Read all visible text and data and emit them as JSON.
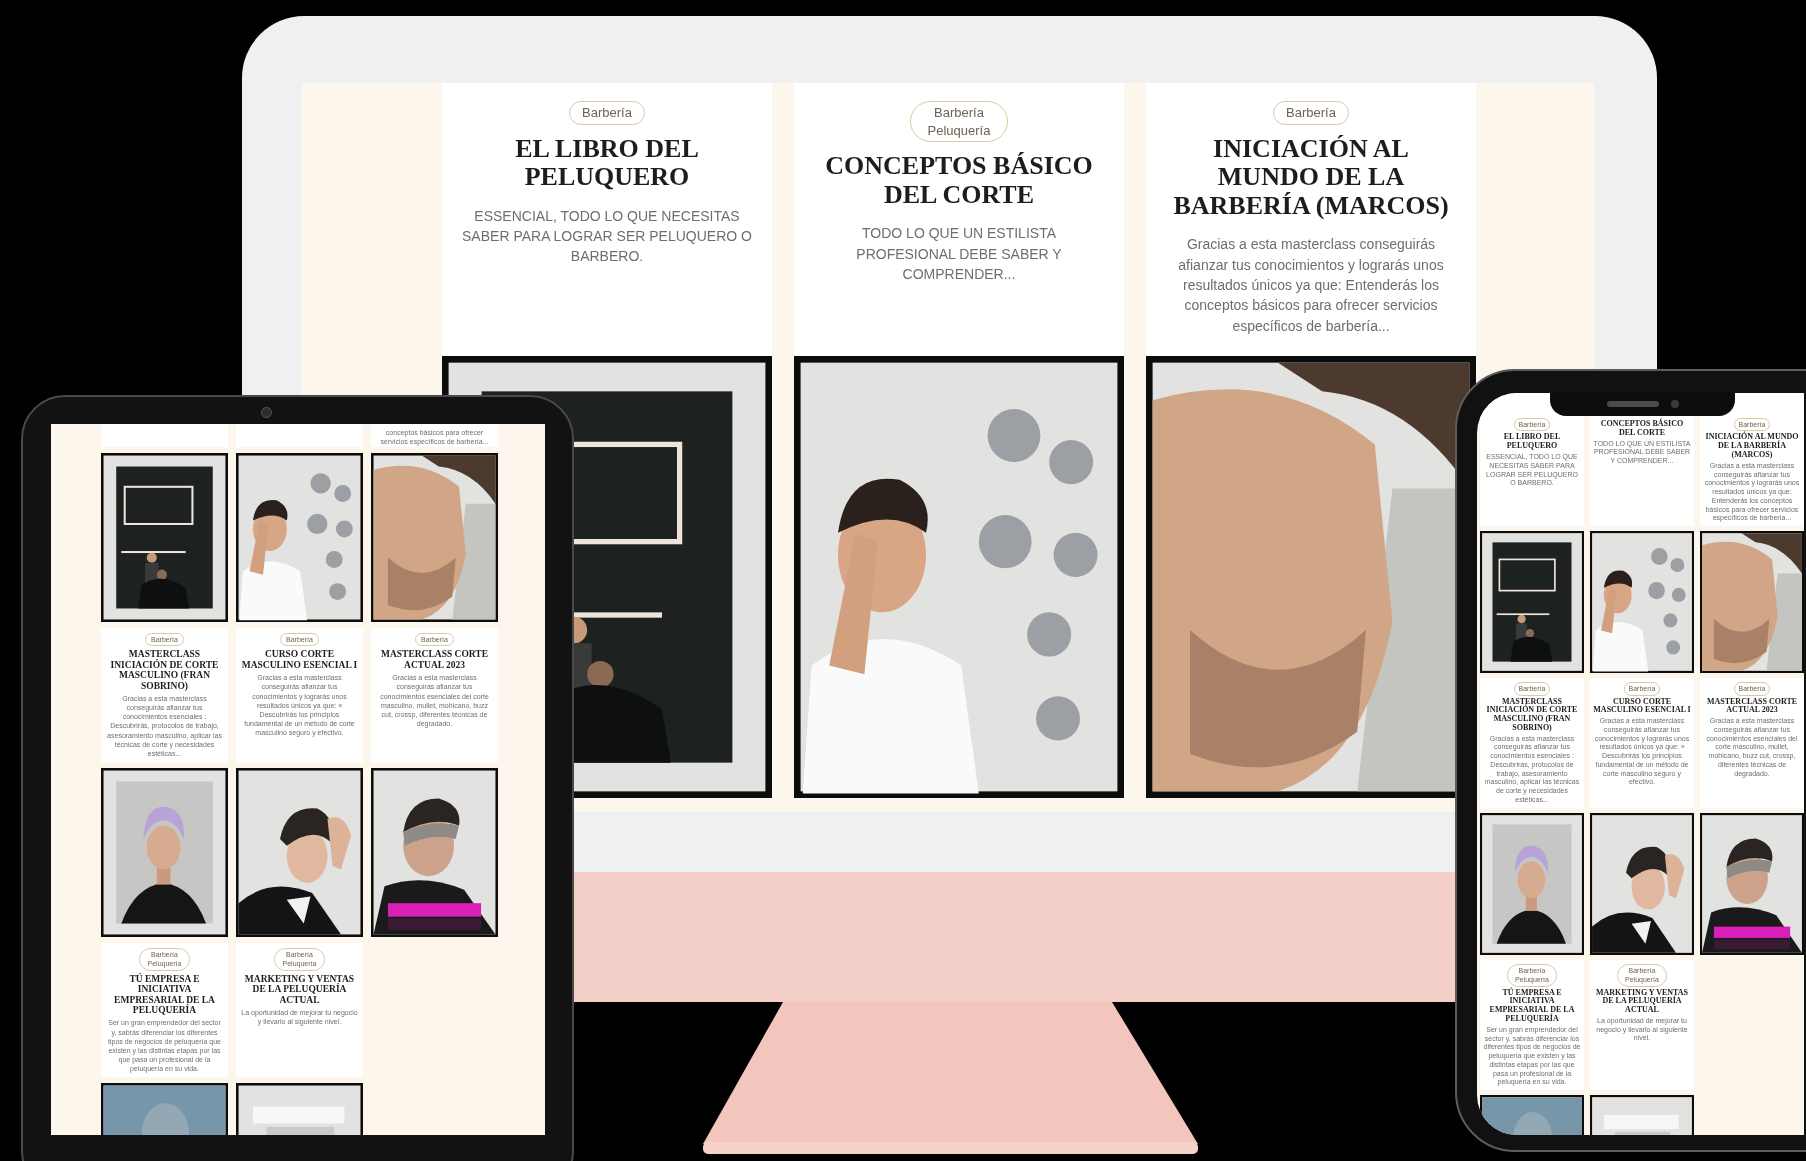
{
  "devices": [
    {
      "kind": "desktop",
      "cards": [
        {
          "tag": "Barbería",
          "title": "EL LIBRO DEL PELUQUERO",
          "description": "ESSENCIAL, TODO LO QUE NECESITAS SABER PARA LOGRAR SER PELUQUERO O BARBERO."
        },
        {
          "tag": "Barbería Peluquería",
          "title": "CONCEPTOS BÁSICO DEL CORTE",
          "description": "TODO LO QUE UN ESTILISTA PROFESIONAL DEBE SABER Y COMPRENDER..."
        },
        {
          "tag": "Barbería",
          "title": "INICIACIÓN AL MUNDO DE LA BARBERÍA (MARCOS)",
          "description": "Gracias a esta masterclass conseguirás afianzar tus conocimientos y lograrás unos resultados únicos ya que: Entenderás los conceptos básicos para ofrecer servicios específicos de barbería..."
        }
      ]
    },
    {
      "kind": "tablet",
      "cards": [
        {
          "kind": "blank"
        },
        {
          "kind": "blank"
        },
        {
          "kind": "excerpt",
          "description": "conceptos básicos para ofrecer servicios específicos de barbería..."
        },
        {
          "kind": "course",
          "tag": "Barbería",
          "title": "MASTERCLASS INICIACIÓN DE CORTE MASCULINO (FRAN SOBRINO)",
          "description": "Gracias a esta masterclass conseguirás afianzar tus conocimientos esenciales : Descubrirás, protocolos de trabajo, asesoramiento masculino, aplicar las técnicas de corte y necesidades estéticas..."
        },
        {
          "kind": "course",
          "tag": "Barbería",
          "title": "CURSO CORTE MASCULINO ESENCIAL I",
          "description": "Gracias a esta masterclass conseguirás afianzar tus conocimientos y lograrás unos resultados únicos ya que: » Descubrirás los principios fundamental de un método de corte masculino seguro y efectivo."
        },
        {
          "kind": "course",
          "tag": "Barbería",
          "title": "MASTERCLASS CORTE ACTUAL 2023",
          "description": "Gracias a esta masterclass conseguirás afianzar tus conocimientos esenciales del corte masculino, mullet, mohicano, buzz cut, crossp, diferentes técnicas de degradado."
        },
        {
          "kind": "course",
          "tag": "Barbería Peluquería",
          "title": "TÚ EMPRESA E INICIATIVA EMPRESARIAL DE LA PELUQUERÍA",
          "description": "Ser un gran emprendedor del sector y, sabrás diferenciar los diferentes tipos de negocios de peluquería que existen y las distintas etapas por las que pasa un profesional de la peluquería en su vida."
        },
        {
          "kind": "course",
          "tag": "Barbería Peluquería",
          "title": "MARKETING Y VENTAS DE LA PELUQUERÍA ACTUAL",
          "description": "La oportunidad de mejorar tu negocio y llevarlo al siguiente nivel."
        }
      ]
    },
    {
      "kind": "phone",
      "cards": [
        {
          "tag": "Barbería",
          "title": "EL LIBRO DEL PELUQUERO",
          "description": "ESSENCIAL, TODO LO QUE NECESITAS SABER PARA LOGRAR SER PELUQUERO O BARBERO."
        },
        {
          "title": "CONCEPTOS BÁSICO DEL CORTE",
          "description": "TODO LO QUE UN ESTILISTA PROFESIONAL DEBE SABER Y COMPRENDER..."
        },
        {
          "tag": "Barbería",
          "title": "INICIACIÓN AL MUNDO DE LA BARBERÍA (MARCOS)",
          "description": "Gracias a esta masterclass conseguirás afianzar tus conocimientos y lograrás unos resultados únicos ya que: Entenderás los conceptos básicos para ofrecer servicios específicos de barbería..."
        },
        {
          "tag": "Barbería",
          "title": "MASTERCLASS INICIACIÓN DE CORTE MASCULINO (FRAN SOBRINO)",
          "description": "Gracias a esta masterclass conseguirás afianzar tus conocimientos esenciales : Descubrirás, protocolos de trabajo, asesoramiento masculino, aplicar las técnicas de corte y necesidades estéticas..."
        },
        {
          "tag": "Barbería",
          "title": "CURSO CORTE MASCULINO ESENCIAL I",
          "description": "Gracias a esta masterclass conseguirás afianzar tus conocimientos y lograrás unos resultados únicos ya que: » Descubrirás los principios fundamental de un método de corte masculino seguro y efectivo."
        },
        {
          "tag": "Barbería",
          "title": "MASTERCLASS CORTE ACTUAL 2023",
          "description": "Gracias a esta masterclass conseguirás afianzar tus conocimientos esenciales del corte masculino, mullet, mohicano, buzz cut, crossp, diferentes técnicas de degradado."
        },
        {
          "tag": "Barbería Peluquería",
          "title": "TÚ EMPRESA E INICIATIVA EMPRESARIAL DE LA PELUQUERÍA",
          "description": "Ser un gran emprendedor del sector y, sabrás diferenciar los diferentes tipos de negocios de peluquería que existen y las distintas etapas por las que pasa un profesional de la peluquería en su vida."
        },
        {
          "tag": "Barbería Peluquería",
          "title": "MARKETING Y VENTAS DE LA PELUQUERÍA ACTUAL",
          "description": "La oportunidad de mejorar tu negocio y llevarlo al siguiente nivel."
        }
      ]
    }
  ]
}
